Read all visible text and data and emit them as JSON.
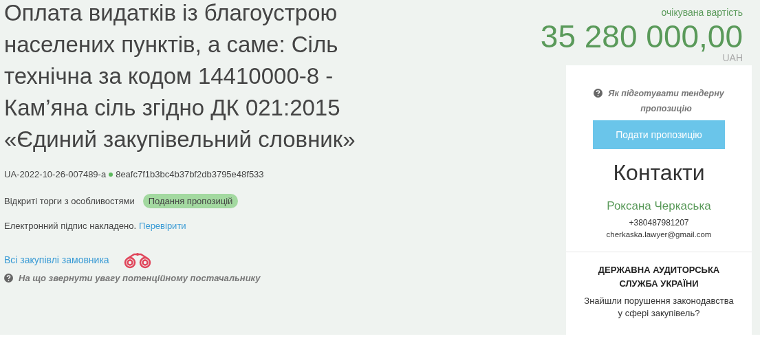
{
  "title": "Оплата видатків із благоустрою населених пунктів, а саме: Сіль технічна за кодом 14410000-8 - Кам’яна сіль згідно ДК 021:2015 «Єдиний закупівельний словник»",
  "tender_id": "UA-2022-10-26-007489-a",
  "hash": "8eafc7f1b3bc4b37bf2db3795e48f533",
  "procedure": "Відкриті торги з особливостями",
  "status_badge": "Подання пропозицій",
  "signature": {
    "text": "Електронний підпис накладено.",
    "link": "Перевірити"
  },
  "buyer_link": "Всі закупівлі замовника",
  "hint": "На що звернути увагу потенційному постачальнику",
  "price": {
    "label": "очікувана вартість",
    "amount": "35 280 000,00",
    "currency": "UAH"
  },
  "sidebar": {
    "help": "Як підготувати тендерну пропозицію",
    "button": "Подати пропозицію",
    "contacts_title": "Контакти",
    "contact_name": "Роксана Черкаська",
    "phone": "+380487981207",
    "email": "cherkaska.lawyer@gmail.com",
    "audit_title": "ДЕРЖАВНА АУДИТОРСЬКА СЛУЖБА УКРАЇНИ",
    "audit_text": "Знайшли порушення законодавства у сфері закупівель?"
  }
}
